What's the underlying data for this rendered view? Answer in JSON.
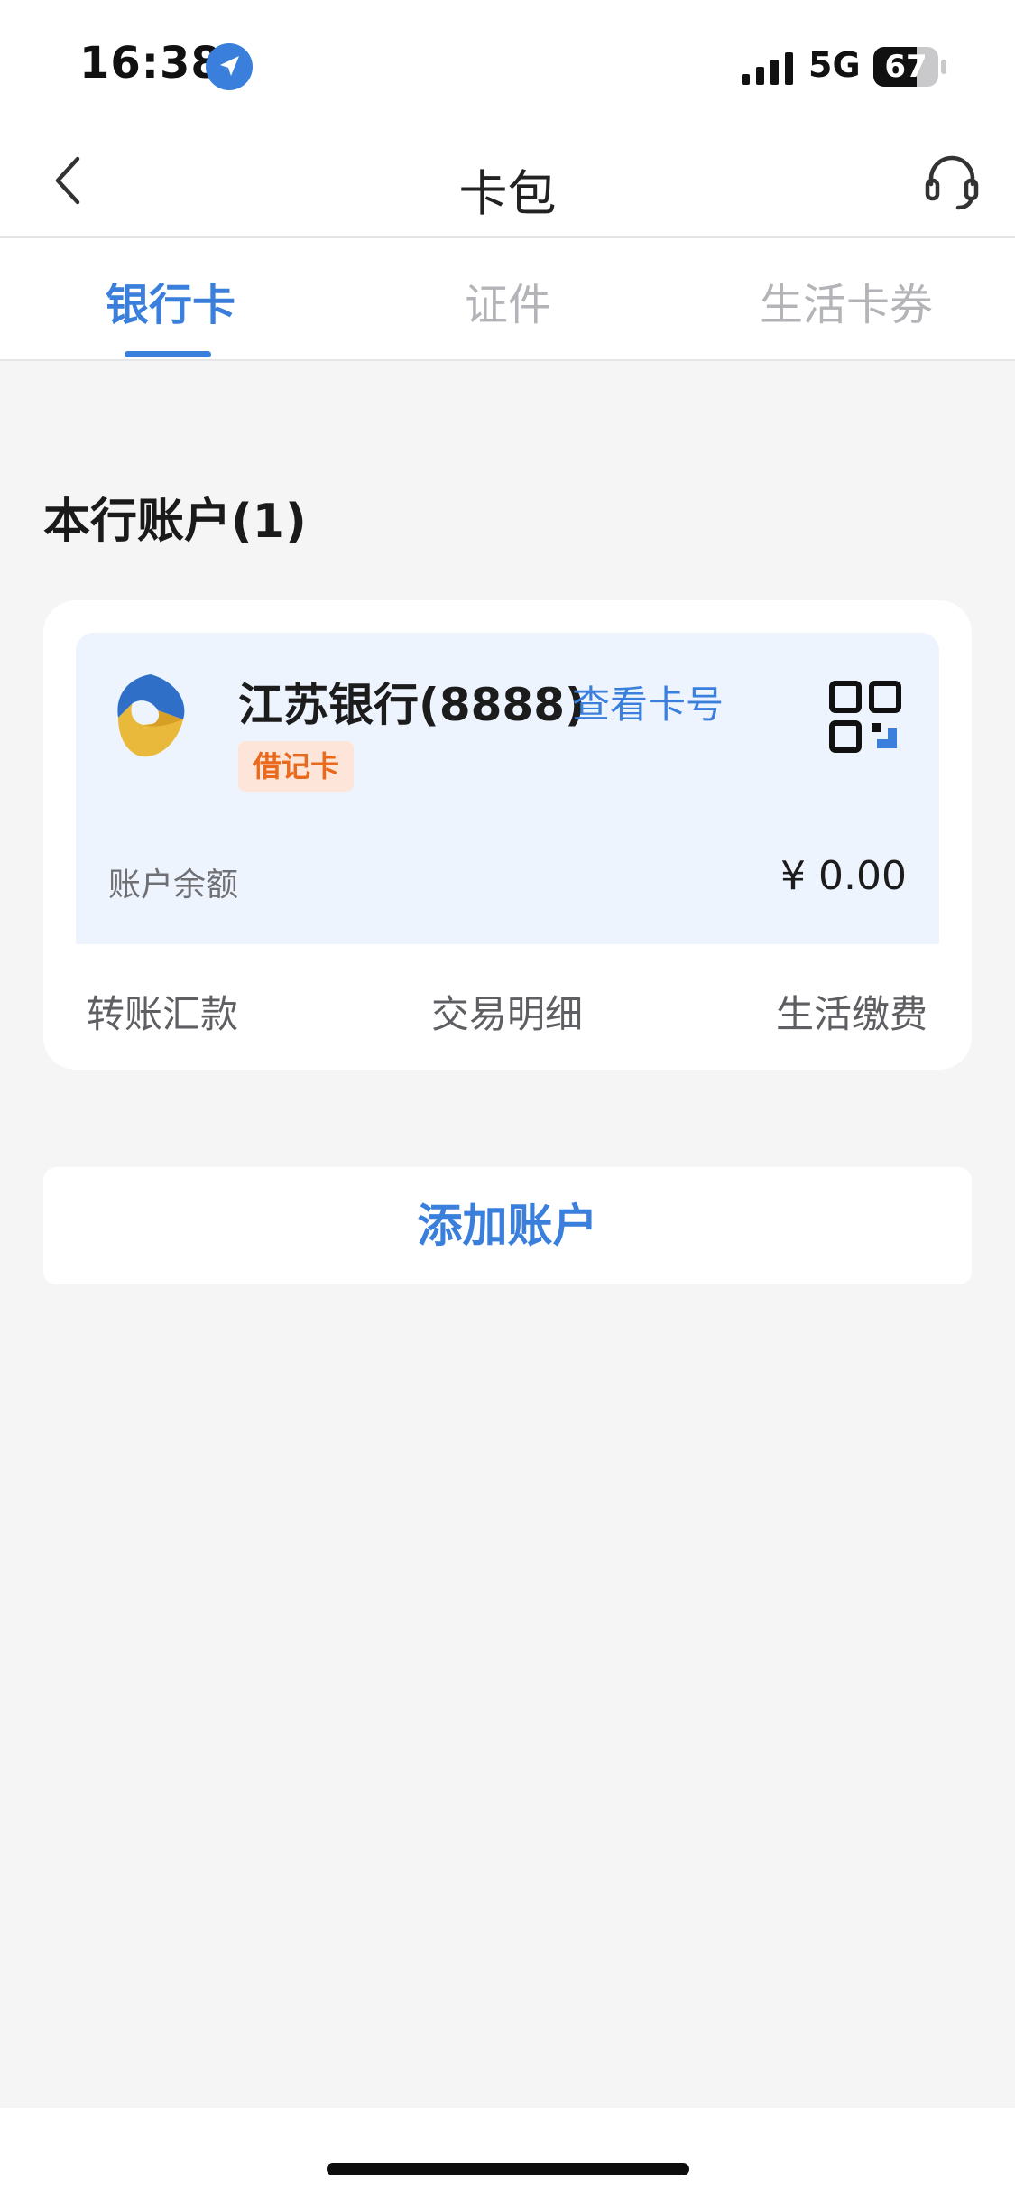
{
  "status_bar": {
    "time": "16:38",
    "network": "5G",
    "battery": "67",
    "icons": [
      "location-icon",
      "signal-icon",
      "battery-icon"
    ]
  },
  "nav": {
    "title": "卡包",
    "icons": [
      "back-icon",
      "customer-service-icon"
    ]
  },
  "tabs": [
    {
      "label": "银行卡",
      "active": true
    },
    {
      "label": "证件",
      "active": false
    },
    {
      "label": "生活卡券",
      "active": false
    }
  ],
  "section": {
    "title": "本行账户(1)"
  },
  "card": {
    "bank_name": "江苏银行(8888)",
    "view_card_number": "查看卡号",
    "card_type": "借记卡",
    "balance_label": "账户余额",
    "balance_value": "¥ 0.00",
    "icons": [
      "bank-logo",
      "qr-code-icon"
    ]
  },
  "actions": [
    {
      "label": "转账汇款"
    },
    {
      "label": "交易明细"
    },
    {
      "label": "生活缴费"
    }
  ],
  "add_account": "添加账户",
  "colors": {
    "accent": "#3a7fdb",
    "badge_bg": "#fde6d9",
    "badge_text": "#ea6a1d",
    "card_bg": "#eef4fe",
    "page_bg": "#f5f5f6"
  }
}
